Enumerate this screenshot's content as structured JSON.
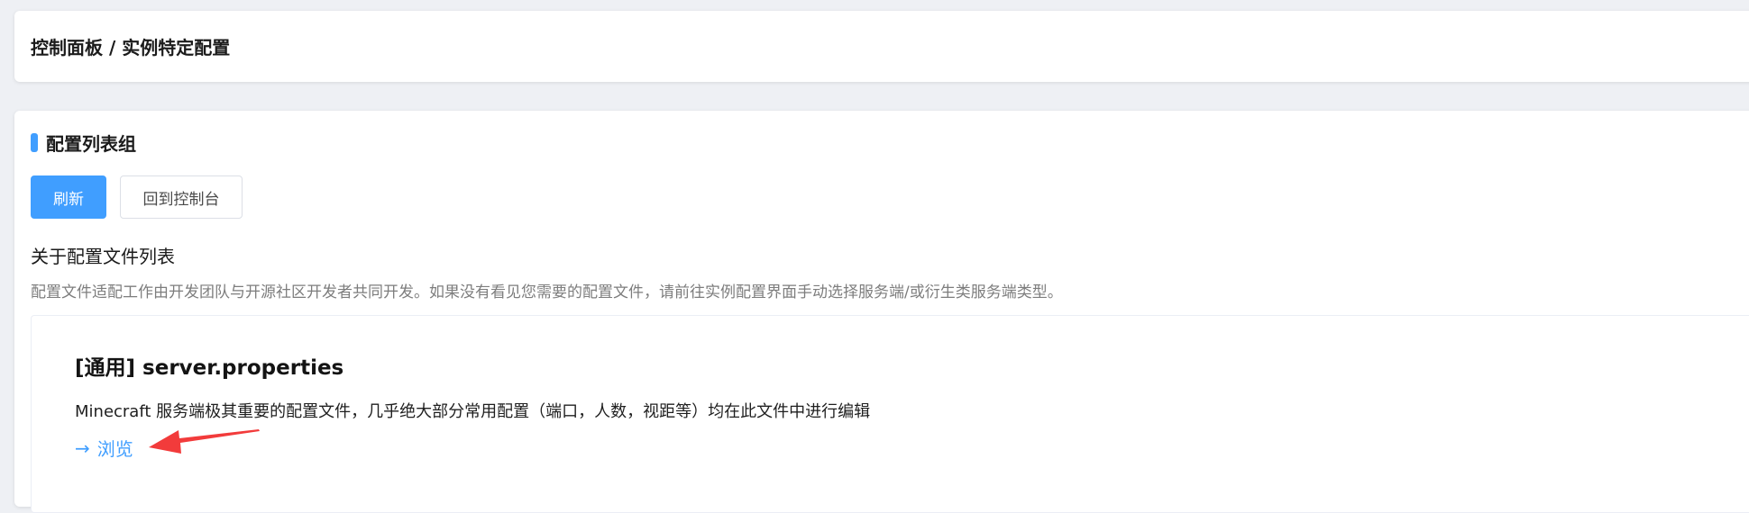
{
  "breadcrumb": {
    "text": "控制面板 / 实例特定配置"
  },
  "section": {
    "title": "配置列表组"
  },
  "buttons": {
    "refresh_label": "刷新",
    "back_label": "回到控制台"
  },
  "about": {
    "title": "关于配置文件列表",
    "description": "配置文件适配工作由开发团队与开源社区开发者共同开发。如果没有看见您需要的配置文件，请前往实例配置界面手动选择服务端/或衍生类服务端类型。"
  },
  "config_item": {
    "title": "[通用] server.properties",
    "description": "Minecraft 服务端极其重要的配置文件，几乎绝大部分常用配置（端口，人数，视距等）均在此文件中进行编辑",
    "browse_label": "浏览"
  },
  "colors": {
    "accent": "#409eff",
    "annotation": "#f23b3b"
  }
}
